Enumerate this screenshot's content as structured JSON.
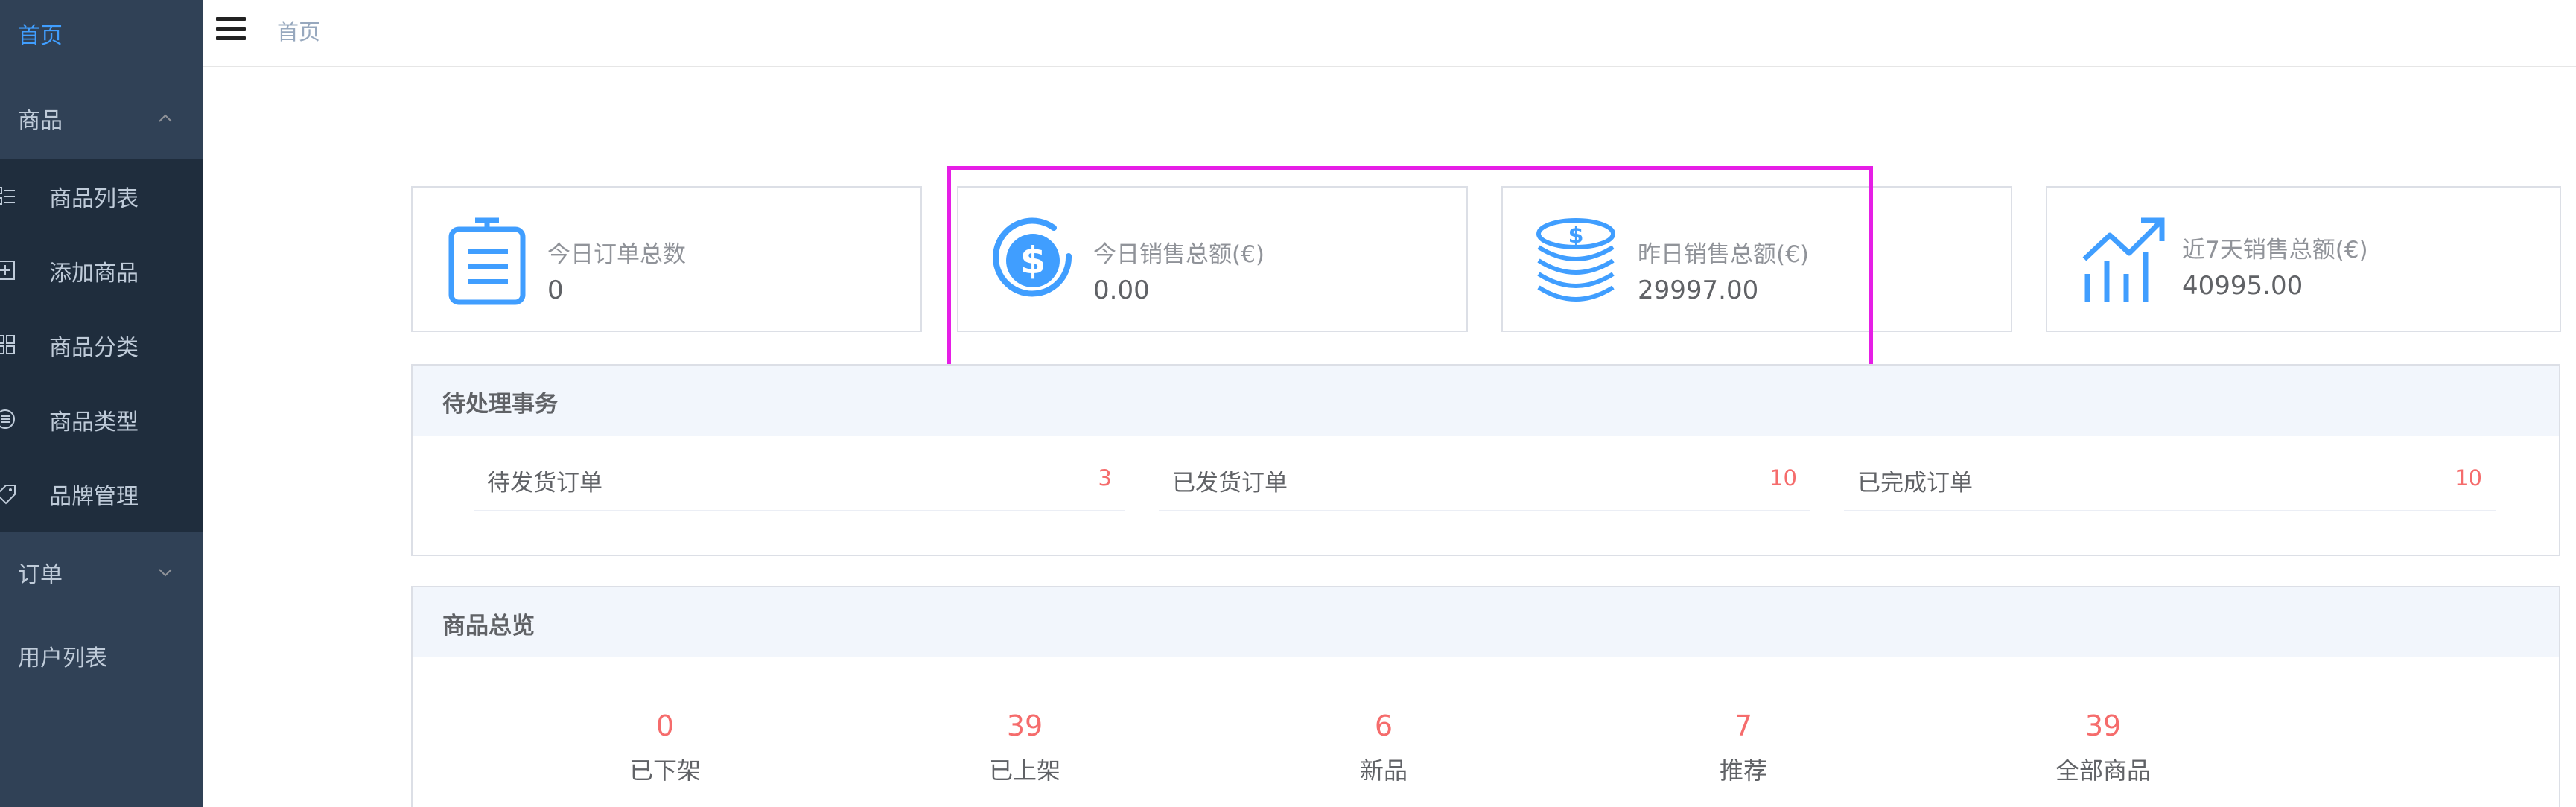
{
  "sidebar": {
    "home": "首页",
    "product_group": "商品",
    "product_items": [
      {
        "label": "商品列表",
        "icon": "product-list-icon"
      },
      {
        "label": "添加商品",
        "icon": "add-product-icon"
      },
      {
        "label": "商品分类",
        "icon": "product-category-icon"
      },
      {
        "label": "商品类型",
        "icon": "product-type-icon"
      },
      {
        "label": "品牌管理",
        "icon": "brand-tag-icon"
      }
    ],
    "order_group": "订单",
    "user_list": "用户列表"
  },
  "header": {
    "breadcrumb": "首页"
  },
  "stats": [
    {
      "title": "今日订单总数",
      "value": "0",
      "icon": "order-clipboard-icon"
    },
    {
      "title": "今日销售总额(€)",
      "value": "0.00",
      "icon": "dollar-circle-icon"
    },
    {
      "title": "昨日销售总额(€)",
      "value": "29997.00",
      "icon": "coin-stack-icon"
    },
    {
      "title": "近7天销售总额(€)",
      "value": "40995.00",
      "icon": "trend-chart-icon"
    }
  ],
  "pending": {
    "title": "待处理事务",
    "items": [
      {
        "label": "待发货订单",
        "count": "3"
      },
      {
        "label": "已发货订单",
        "count": "10"
      },
      {
        "label": "已完成订单",
        "count": "10"
      }
    ]
  },
  "overview": {
    "title": "商品总览",
    "items": [
      {
        "value": "0",
        "label": "已下架"
      },
      {
        "value": "39",
        "label": "已上架"
      },
      {
        "value": "6",
        "label": "新品"
      },
      {
        "value": "7",
        "label": "推荐"
      },
      {
        "value": "39",
        "label": "全部商品"
      }
    ]
  },
  "colors": {
    "sidebar_bg": "#304156",
    "submenu_bg": "#1f2d3d",
    "active_link": "#409eff",
    "icon_blue": "#409eff",
    "count_red": "#f56c6c",
    "highlight_magenta": "#e61ee6"
  }
}
